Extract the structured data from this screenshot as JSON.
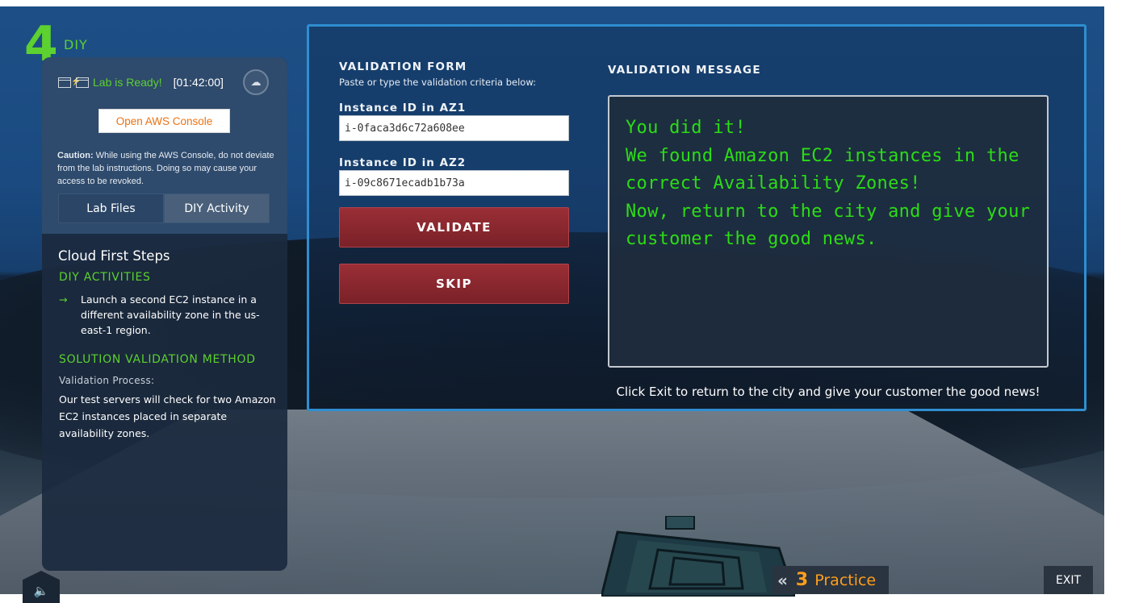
{
  "step": {
    "number": "4",
    "label": "DIY"
  },
  "lab": {
    "status": "Lab is Ready!",
    "timer": "[01:42:00]",
    "console_button": "Open AWS Console",
    "caution_label": "Caution:",
    "caution_text": "While using the AWS Console, do not deviate from the lab instructions. Doing so may cause your access to be revoked."
  },
  "tabs": [
    {
      "label": "Lab Files"
    },
    {
      "label": "DIY Activity"
    }
  ],
  "sidebar": {
    "title": "Cloud First Steps",
    "activities_heading": "DIY ACTIVITIES",
    "activity": "Launch a second EC2 instance in a different availability zone in the us-east-1 region.",
    "solution_heading": "SOLUTION VALIDATION METHOD",
    "process_label": "Validation Process:",
    "process_text": "Our test servers will check for two Amazon EC2 instances placed in separate availability zones."
  },
  "form": {
    "title": "VALIDATION FORM",
    "subtitle": "Paste or type the validation criteria below:",
    "field1_label": "Instance ID in AZ1",
    "field1_value": "i-0faca3d6c72a608ee",
    "field2_label": "Instance ID in AZ2",
    "field2_value": "i-09c8671ecadb1b73a",
    "validate_button": "VALIDATE",
    "skip_button": "SKIP"
  },
  "message": {
    "title": "VALIDATION MESSAGE",
    "lines": [
      "You did it!",
      "We found Amazon EC2 instances in the",
      "correct Availability Zones!",
      "Now, return to the city and give your",
      "customer the good news."
    ],
    "exit_note": "Click Exit to return to the city and give your customer the good news!"
  },
  "footer": {
    "practice_number": "3",
    "practice_label": "Practice",
    "exit_button": "EXIT"
  },
  "icons": [
    "window-connect-icon",
    "cloud-icon",
    "arrow-right-icon",
    "speaker-icon",
    "double-chevron-left-icon"
  ],
  "colors": {
    "accent_green": "#5cd12f",
    "message_green": "#2cdc15",
    "aws_orange": "#ec7211",
    "practice_orange": "#ff9e1b",
    "button_red": "#8a2830",
    "panel_border": "#2f8ed0"
  }
}
